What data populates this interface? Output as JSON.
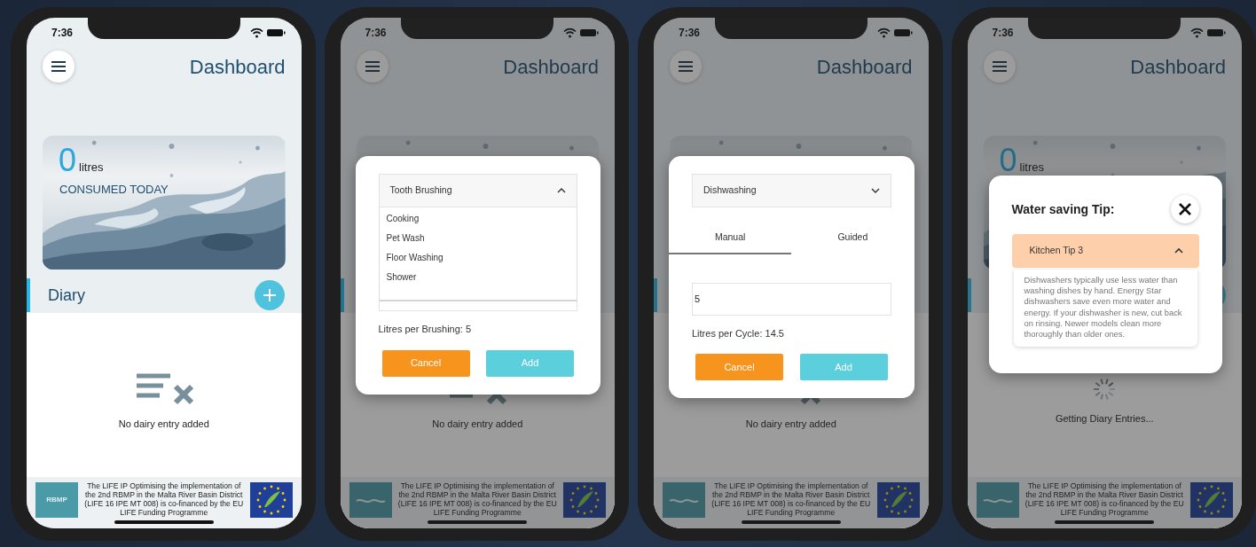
{
  "phones": [
    {
      "time": "7:36",
      "title": "Dashboard",
      "hero": {
        "value": "0",
        "unit": "litres",
        "caption": "CONSUMED TODAY"
      },
      "diary_label": "Diary",
      "add_button": true,
      "empty_state": {
        "kind": "empty",
        "text": "No dairy entry added"
      },
      "footer": {
        "logo_text": "RBMP",
        "text": "The LIFE IP Optimising the implementation of the 2nd RBMP in the Malta River Basin District (LIFE 16 IPE MT 008) is co-financed by the EU LIFE Funding Programme"
      }
    },
    {
      "time": "7:36",
      "title": "Dashboard",
      "add_button": false,
      "empty_state": {
        "kind": "empty",
        "text": "No dairy entry added"
      },
      "footer": {
        "text": "The LIFE IP Optimising the implementation of the 2nd RBMP in the Malta River Basin District (LIFE 16 IPE MT 008) is co-financed by the EU LIFE Funding Programme"
      },
      "modal": {
        "kind": "activity",
        "select": {
          "value": "Tooth Brushing",
          "expanded": true,
          "options": [
            "Cooking",
            "Pet Wash",
            "Floor Washing",
            "Shower"
          ]
        },
        "reading": "Litres per Brushing: 5",
        "buttons": [
          {
            "label": "Cancel",
            "kind": "cancel"
          },
          {
            "label": "Add",
            "kind": "add"
          }
        ]
      }
    },
    {
      "time": "7:36",
      "title": "Dashboard",
      "add_button": false,
      "empty_state": {
        "kind": "empty",
        "text": "No dairy entry added"
      },
      "footer": {
        "text": "The LIFE IP Optimising the implementation of the 2nd RBMP in the Malta River Basin District (LIFE 16 IPE MT 008) is co-financed by the EU LIFE Funding Programme"
      },
      "modal": {
        "kind": "activity",
        "select": {
          "value": "Dishwashing",
          "expanded": false
        },
        "tabs": [
          {
            "label": "Manual",
            "selected": true
          },
          {
            "label": "Guided",
            "selected": false
          }
        ],
        "input": {
          "value": "5"
        },
        "reading": "Litres per Cycle: 14.5",
        "buttons": [
          {
            "label": "Cancel",
            "kind": "cancel"
          },
          {
            "label": "Add",
            "kind": "add"
          }
        ]
      }
    },
    {
      "time": "7:36",
      "title": "Dashboard",
      "hero": {
        "value": "0",
        "unit": "litres"
      },
      "add_button": true,
      "empty_state": {
        "kind": "loading",
        "text": "Getting Diary Entries..."
      },
      "footer": {
        "text": "The LIFE IP Optimising the implementation of the 2nd RBMP in the Malta River Basin District (LIFE 16 IPE MT 008) is co-financed by the EU LIFE Funding Programme"
      },
      "modal": {
        "kind": "tip",
        "title": "Water saving Tip:",
        "tip": {
          "title": "Kitchen Tip 3",
          "expanded": true,
          "body": "Dishwashers typically use less water than washing dishes by hand. Energy Star dishwashers save even more water and energy. If your dishwasher is new, cut back on rinsing. Newer models clean more thoroughly than older ones."
        }
      }
    }
  ]
}
